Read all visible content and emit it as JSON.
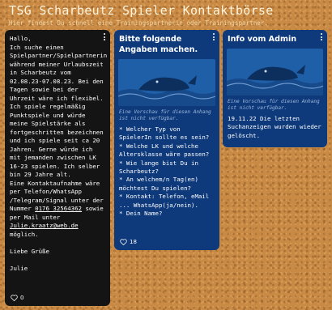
{
  "header": {
    "title": "TSG Scharbeutz Spieler Kontaktbörse",
    "subtitle": "Hier findest Du schnell eine Trainingspartnerin oder Trainingspartner."
  },
  "cards": [
    {
      "text_before_phone": "Hallo,\nIch suche einen Spielpartner/Spielpartnerin während meiner Urlaubszeit in Scharbeutz vom 02.08.23-07.08.23. Bei den Tagen sowie bei der Uhrzeit wäre ich flexibel.\nIch spiele regelmäßig Punktspiele und würde meine Spielstärke als fortgeschritten bezeichnen und ich spiele seit ca 20 Jahren. Gerne würde ich mit jemanden zwischen LK 16-23 spielen. Ich selber bin 29 Jahre alt.\nEine Kontaktaufnahme wäre per Telefon/WhatsApp /Telegram/Signal unter der Nummer ",
      "phone": "0176 32564362",
      "text_mid": " sowie per Mail unter ",
      "email": "Julie.kraatz@web.de",
      "text_after": "\nmöglich.\n\nLiebe Grüße\n\nJulie",
      "likes": "0"
    },
    {
      "title": "Bitte folgende Angaben machen.",
      "image_caption": "Eine Vorschau für diesen Anhang ist nicht verfügbar.",
      "body": "* Welcher Typ von SpielerIn sollte es sein?\n* Welche LK und welche Altersklasse wäre passen?\n* Wie lange bist Du in Scharbeutz?\n* An welchem/n Tag(en) möchtest Du spielen?\n* Kontakt: Telefon, eMail ... WhatsApp(ja/nein).\n* Dein Name?",
      "likes": "18"
    },
    {
      "title": "Info vom Admin",
      "image_caption": "Eine Vorschau für diesen Anhang ist nicht verfügbar.",
      "body": "19.11.22 Die letzten Suchanzeigen wurden wieder gelöscht."
    }
  ],
  "colors": {
    "background": "#c98a45",
    "dark_card": "#141414",
    "blue_card": "#0e3a7c",
    "image_placeholder": "#1f5fa8"
  },
  "icons": {
    "menu": "more-vertical-icon",
    "like": "heart-icon",
    "placeholder": "whale-image-icon"
  }
}
